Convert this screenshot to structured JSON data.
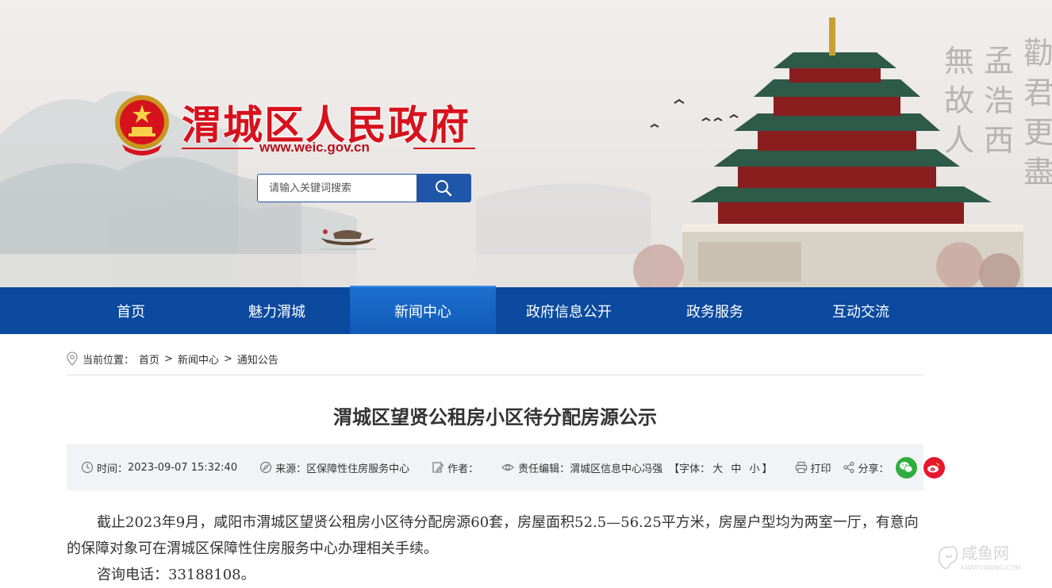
{
  "site": {
    "title": "渭城区人民政府",
    "url": "www.weic.gov.cn"
  },
  "search": {
    "placeholder": "请输入关键词搜索"
  },
  "nav": {
    "items": [
      "首页",
      "魅力渭城",
      "新闻中心",
      "政府信息公开",
      "政务服务",
      "互动交流"
    ],
    "active_index": 2
  },
  "breadcrumb": {
    "label": "当前位置：",
    "items": [
      "首页",
      "新闻中心",
      "通知公告"
    ],
    "separator": ">"
  },
  "article": {
    "title": "渭城区望贤公租房小区待分配房源公示",
    "meta": {
      "time_label": "时间：",
      "time": "2023-09-07 15:32:40",
      "source_label": "来源：",
      "source": "区保障性住房服务中心",
      "author_label": "作者：",
      "author": "",
      "editor_label": "责任编辑：",
      "editor": "渭城区信息中心冯强",
      "font_open": "【字体：",
      "font_sizes": [
        "大",
        "中",
        "小"
      ],
      "font_close": "】",
      "print": "打印",
      "share_label": "分享："
    },
    "paragraphs": [
      "截止2023年9月，咸阳市渭城区望贤公租房小区待分配房源60套，房屋面积52.5—56.25平方米，房屋户型均为两室一厅，有意向的保障对象可在渭城区保障性住房服务中心办理相关手续。",
      "咨询电话：33188108。"
    ]
  },
  "watermark": {
    "text": "咸鱼网",
    "sub": "XIANYUWANG.COM"
  },
  "colors": {
    "nav_bg": "#0b4a9e",
    "nav_active": "#1565c8",
    "title_red": "#d6121d",
    "meta_bg": "#f2f3f6",
    "wechat": "#2dae3f",
    "weibo": "#e6162d"
  },
  "icons": {
    "search": "magnifier-icon",
    "location": "location-pin-icon",
    "time": "clock-icon",
    "source": "compass-icon",
    "author": "pen-icon",
    "editor": "eye-icon",
    "print": "printer-icon",
    "share": "share-icon",
    "wechat": "wechat-icon",
    "weibo": "weibo-icon"
  }
}
